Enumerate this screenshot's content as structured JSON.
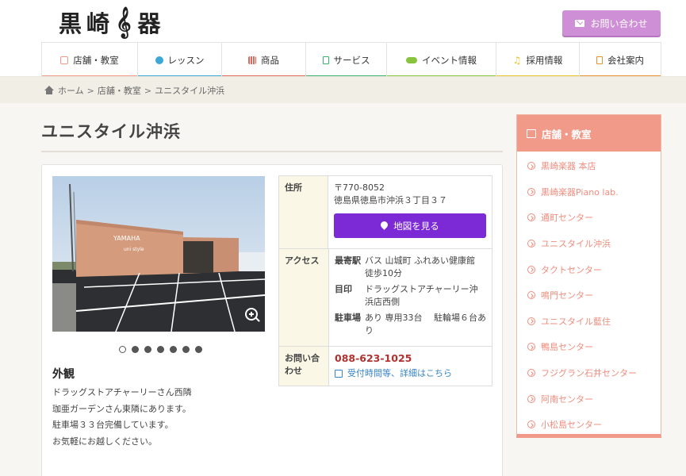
{
  "header": {
    "logo_text_1": "黒崎",
    "logo_text_2": "器",
    "contact_label": "お問い合わせ"
  },
  "nav": [
    {
      "label": "店舗・教室",
      "color": "#f29a8a"
    },
    {
      "label": "レッスン",
      "color": "#3ba8d6"
    },
    {
      "label": "商品",
      "color": "#e0685c"
    },
    {
      "label": "サービス",
      "color": "#3bb36e"
    },
    {
      "label": "イベント情報",
      "color": "#8ac43f"
    },
    {
      "label": "採用情報",
      "color": "#e8c424"
    },
    {
      "label": "会社案内",
      "color": "#e8922f"
    }
  ],
  "breadcrumb": {
    "home": "ホーム",
    "sep": ">",
    "parent": "店舗・教室",
    "current": "ユニスタイル沖浜"
  },
  "page": {
    "title": "ユニスタイル沖浜",
    "photo_sign_1": "YAMAHA",
    "photo_sign_2": "uni style",
    "caption_title": "外観",
    "caption_lines": [
      "ドラッグストアチャーリーさん西隣",
      "珈亜ガーデンさん東隣にあります。",
      "駐車場３３台完備しています。",
      "お気軽にお越しください。"
    ]
  },
  "info": {
    "address_label": "住所",
    "postal": "〒770-8052",
    "address": "徳島県徳島市沖浜３丁目３７",
    "map_button": "地図を見る",
    "access_label": "アクセス",
    "access": [
      {
        "key": "最寄駅",
        "value": "バス 山城町 ふれあい健康館 徒歩10分"
      },
      {
        "key": "目印",
        "value": "ドラッグストアチャーリー沖浜店西側"
      },
      {
        "key": "駐車場",
        "value": "あり 専用33台　 駐輪場６台あり"
      }
    ],
    "contact_label": "お問い合わせ",
    "phone": "088-623-1025",
    "hours_link": "受付時間等、詳細はこちら"
  },
  "sidebar": {
    "title": "店舗・教室",
    "items": [
      "黒崎楽器 本店",
      "黒崎楽器Piano lab.",
      "通町センター",
      "ユニスタイル沖浜",
      "タクトセンター",
      "鳴門センター",
      "ユニスタイル藍住",
      "鴨島センター",
      "フジグラン石井センター",
      "阿南センター",
      "小松島センター"
    ]
  }
}
